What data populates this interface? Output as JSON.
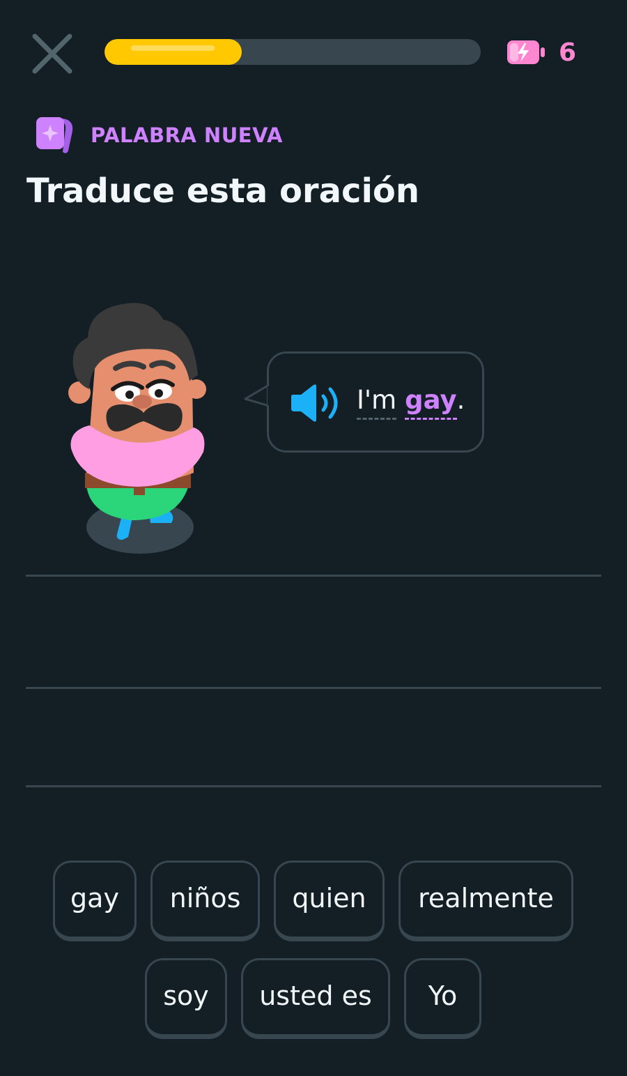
{
  "top_bar": {
    "progress_fraction": 0.365,
    "energy_count": "6",
    "colors": {
      "progress": "#ffc800",
      "energy": "#ff86d0"
    }
  },
  "header": {
    "badge_label": "PALABRA NUEVA",
    "badge_icon": "new-word-card-icon",
    "title": "Traduce esta oración"
  },
  "prompt": {
    "words": [
      {
        "text": "I'm",
        "type": "hint"
      },
      {
        "text": "gay",
        "type": "new"
      },
      {
        "text": ".",
        "type": "punct"
      }
    ],
    "audio_icon": "speaker-icon"
  },
  "word_bank": {
    "chips": [
      "gay",
      "niños",
      "quien",
      "realmente",
      "soy",
      "usted es",
      "Yo"
    ]
  },
  "colors": {
    "background": "#131f24",
    "border": "#37464f",
    "accent_purple": "#ce82ff",
    "accent_blue": "#1cb0f6"
  }
}
